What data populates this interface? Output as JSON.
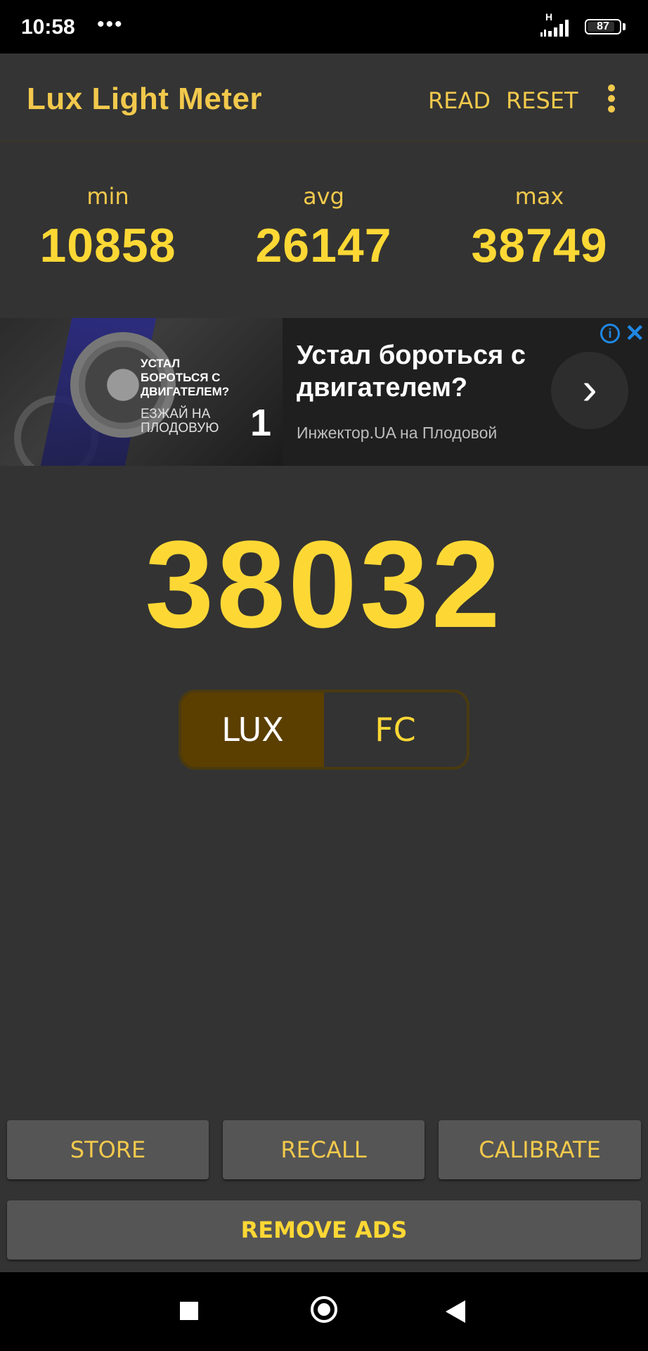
{
  "status_bar": {
    "time": "10:58",
    "dots": "•••",
    "network": "H",
    "battery": "87"
  },
  "app_bar": {
    "title": "Lux Light Meter",
    "read_label": "READ",
    "reset_label": "RESET",
    "menu_icon": "more-vert-icon"
  },
  "stats": [
    {
      "label": "min",
      "value": "10858"
    },
    {
      "label": "avg",
      "value": "26147"
    },
    {
      "label": "max",
      "value": "38749"
    }
  ],
  "ad": {
    "image_text": "УСТАЛ БОРОТЬСЯ С ДВИГАТЕЛЕМ?",
    "image_sub": "ЕЗЖАЙ НА ПЛОДОВУЮ",
    "image_num": "1",
    "title": "Устал бороться с двигателем?",
    "subtitle": "Инжектор.UA на Плодовой",
    "arrow": "›",
    "info": "i",
    "close": "✕"
  },
  "reading": {
    "value": "38032"
  },
  "units": {
    "lux": "LUX",
    "fc": "FC",
    "selected": "LUX"
  },
  "buttons": {
    "store": "STORE",
    "recall": "RECALL",
    "calibrate": "CALIBRATE",
    "remove_ads": "REMOVE ADS"
  },
  "colors": {
    "accent": "#fdd835",
    "background": "#333333",
    "selected_unit_bg": "#5b3f00",
    "button_bg": "#555555"
  }
}
